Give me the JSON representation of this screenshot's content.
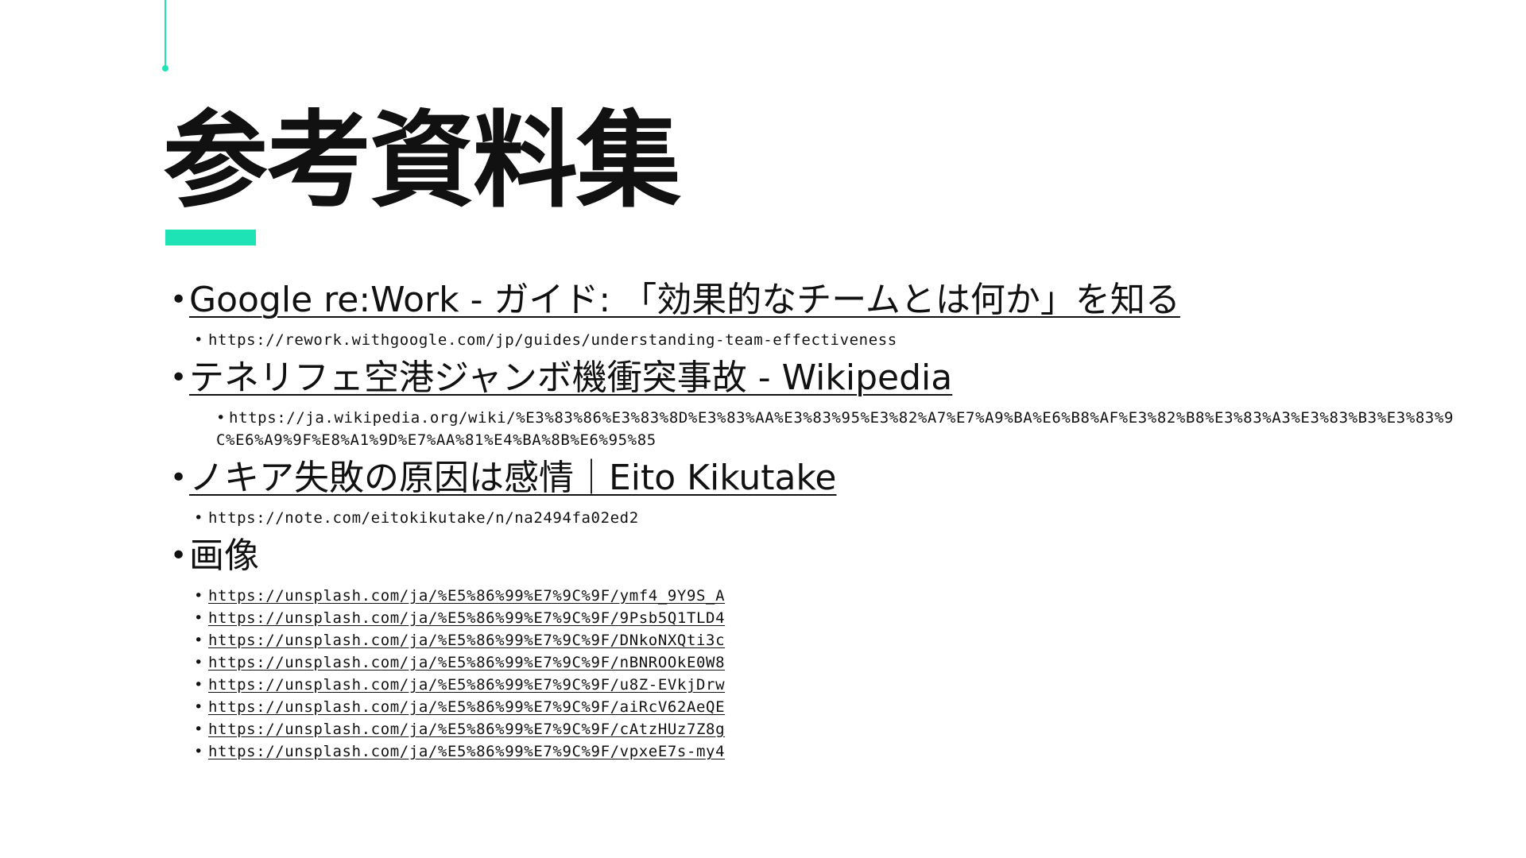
{
  "title": "参考資料集",
  "colors": {
    "accent": "#1ee3b4",
    "text": "#111111",
    "background": "#ffffff"
  },
  "references": [
    {
      "title": "Google re:Work - ガイド: 「効果的なチームとは何か」を知る",
      "url": "https://rework.withgoogle.com/jp/guides/understanding-team-effectiveness"
    },
    {
      "title": "テネリフェ空港ジャンボ機衝突事故 - Wikipedia",
      "url": "https://ja.wikipedia.org/wiki/%E3%83%86%E3%83%8D%E3%83%AA%E3%83%95%E3%82%A7%E7%A9%BA%E6%B8%AF%E3%82%B8%E3%83%A3%E3%83%B3%E3%83%9C%E6%A9%9F%E8%A1%9D%E7%AA%81%E4%BA%8B%E6%95%85"
    },
    {
      "title": "ノキア失敗の原因は感情｜Eito Kikutake",
      "url": "https://note.com/eitokikutake/n/na2494fa02ed2"
    }
  ],
  "images": {
    "label": "画像",
    "urls": [
      "https://unsplash.com/ja/%E5%86%99%E7%9C%9F/ymf4_9Y9S_A",
      "https://unsplash.com/ja/%E5%86%99%E7%9C%9F/9Psb5Q1TLD4",
      "https://unsplash.com/ja/%E5%86%99%E7%9C%9F/DNkoNXQti3c",
      "https://unsplash.com/ja/%E5%86%99%E7%9C%9F/nBNROOkE0W8",
      "https://unsplash.com/ja/%E5%86%99%E7%9C%9F/u8Z-EVkjDrw",
      "https://unsplash.com/ja/%E5%86%99%E7%9C%9F/aiRcV62AeQE",
      "https://unsplash.com/ja/%E5%86%99%E7%9C%9F/cAtzHUz7Z8g",
      "https://unsplash.com/ja/%E5%86%99%E7%9C%9F/vpxeE7s-my4"
    ]
  }
}
